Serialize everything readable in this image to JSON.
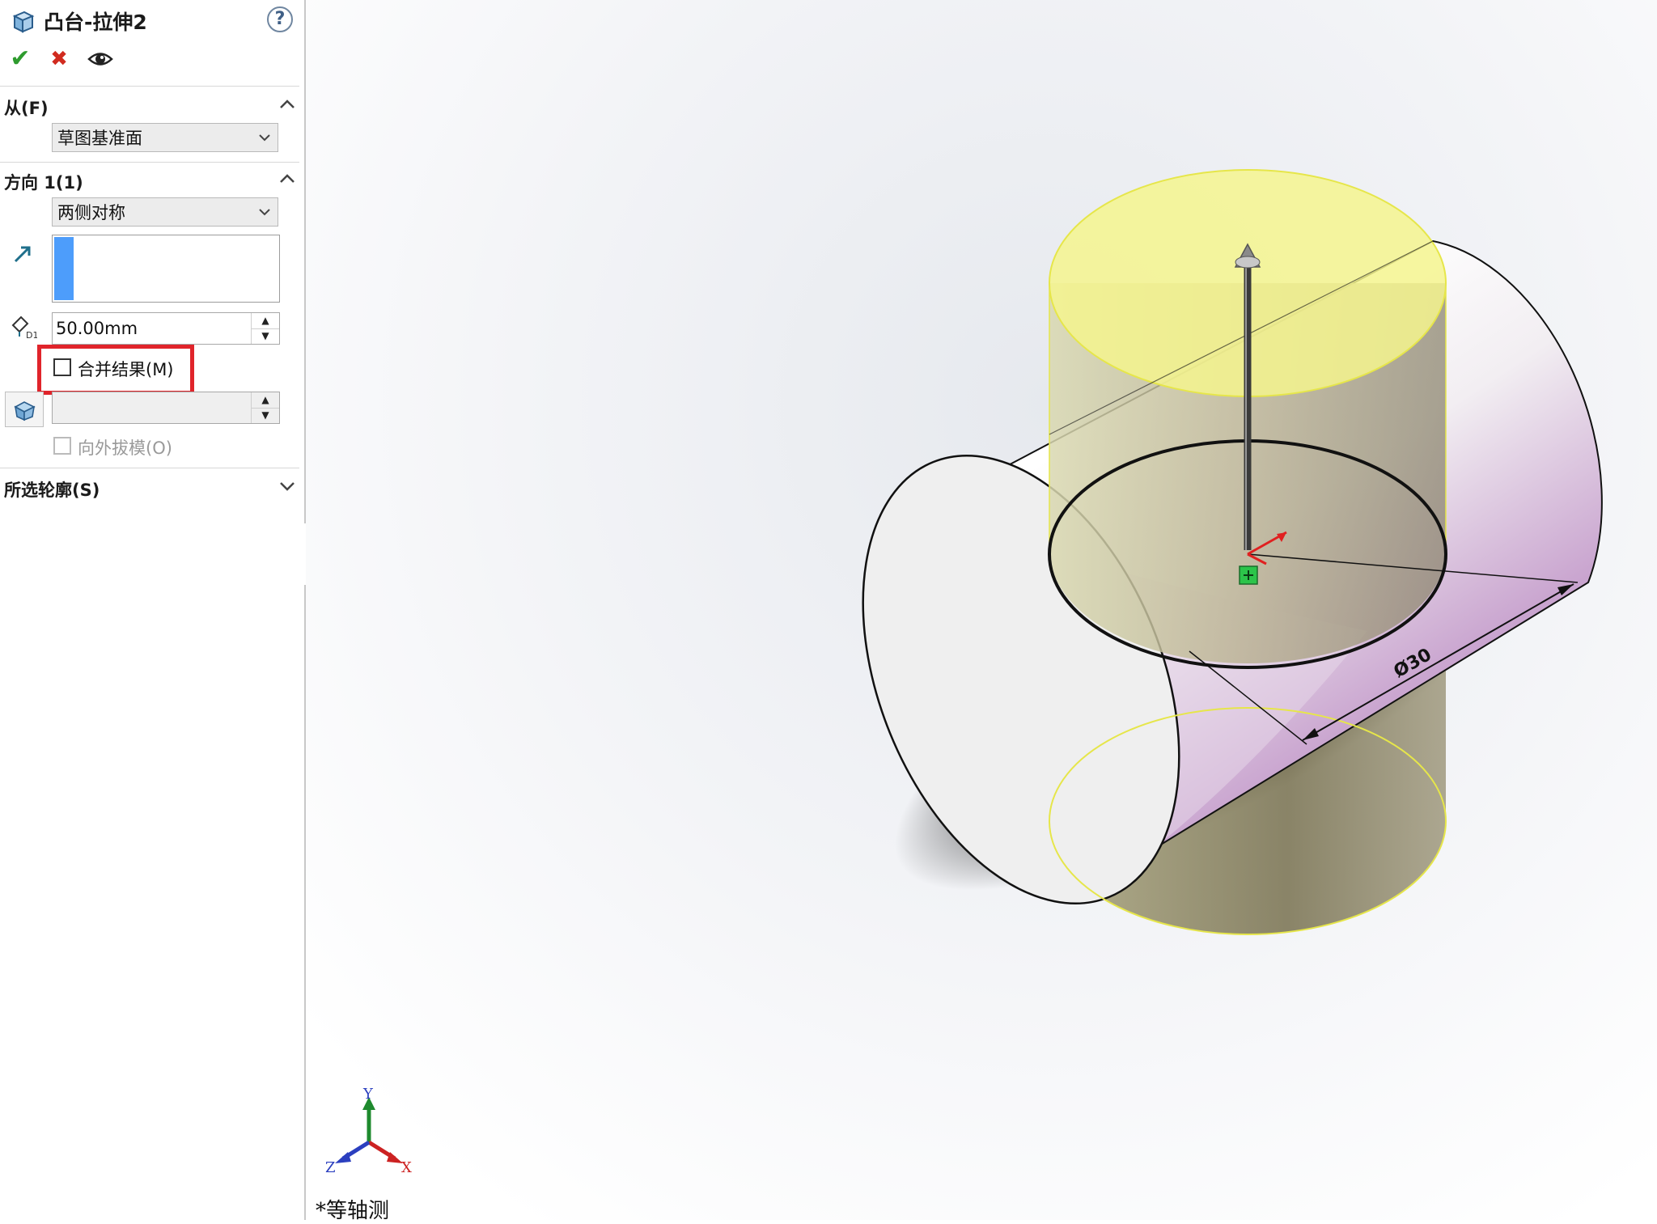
{
  "header": {
    "title": "凸台-拉伸2",
    "help": "?"
  },
  "actions": {
    "ok": "✔",
    "cancel": "✖",
    "preview": "👁"
  },
  "from_section": {
    "label": "从(F)",
    "dropdown_value": "草图基准面"
  },
  "direction1": {
    "label": "方向 1(1)",
    "end_condition": "两侧对称",
    "depth_value": "50.00mm",
    "merge_result_label": "合并结果(M)",
    "merge_result_checked": false,
    "draft_outward_label": "向外拔模(O)"
  },
  "selected_contours": {
    "label": "所选轮廓(S)"
  },
  "viewport": {
    "dimension_label": "Ø30",
    "view_name": "*等轴测",
    "axes": {
      "x": "X",
      "y": "Y",
      "z": "Z"
    }
  },
  "colors": {
    "highlight": "#e0242b",
    "accent": "#4d9dfb",
    "preview_yellow": "#f2f28a"
  }
}
